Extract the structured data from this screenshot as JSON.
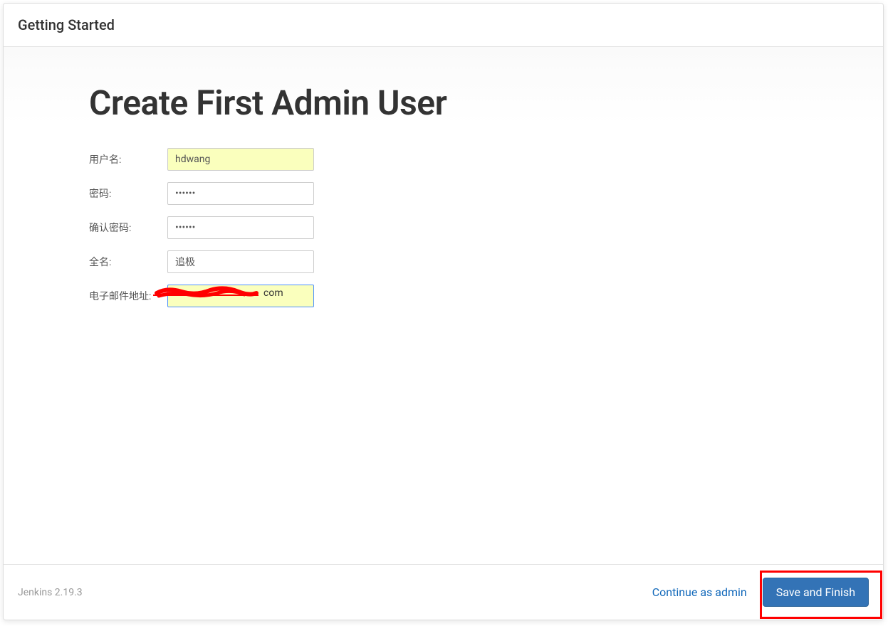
{
  "header": {
    "title": "Getting Started"
  },
  "page": {
    "title": "Create First Admin User"
  },
  "form": {
    "username": {
      "label": "用户名:",
      "value": "hdwang"
    },
    "password": {
      "label": "密码:",
      "value": "••••••"
    },
    "confirm_password": {
      "label": "确认密码:",
      "value": "••••••"
    },
    "fullname": {
      "label": "全名:",
      "value": "追极"
    },
    "email": {
      "label": "电子邮件地址:",
      "value": "com"
    }
  },
  "footer": {
    "version": "Jenkins 2.19.3",
    "continue_label": "Continue as admin",
    "save_label": "Save and Finish"
  }
}
